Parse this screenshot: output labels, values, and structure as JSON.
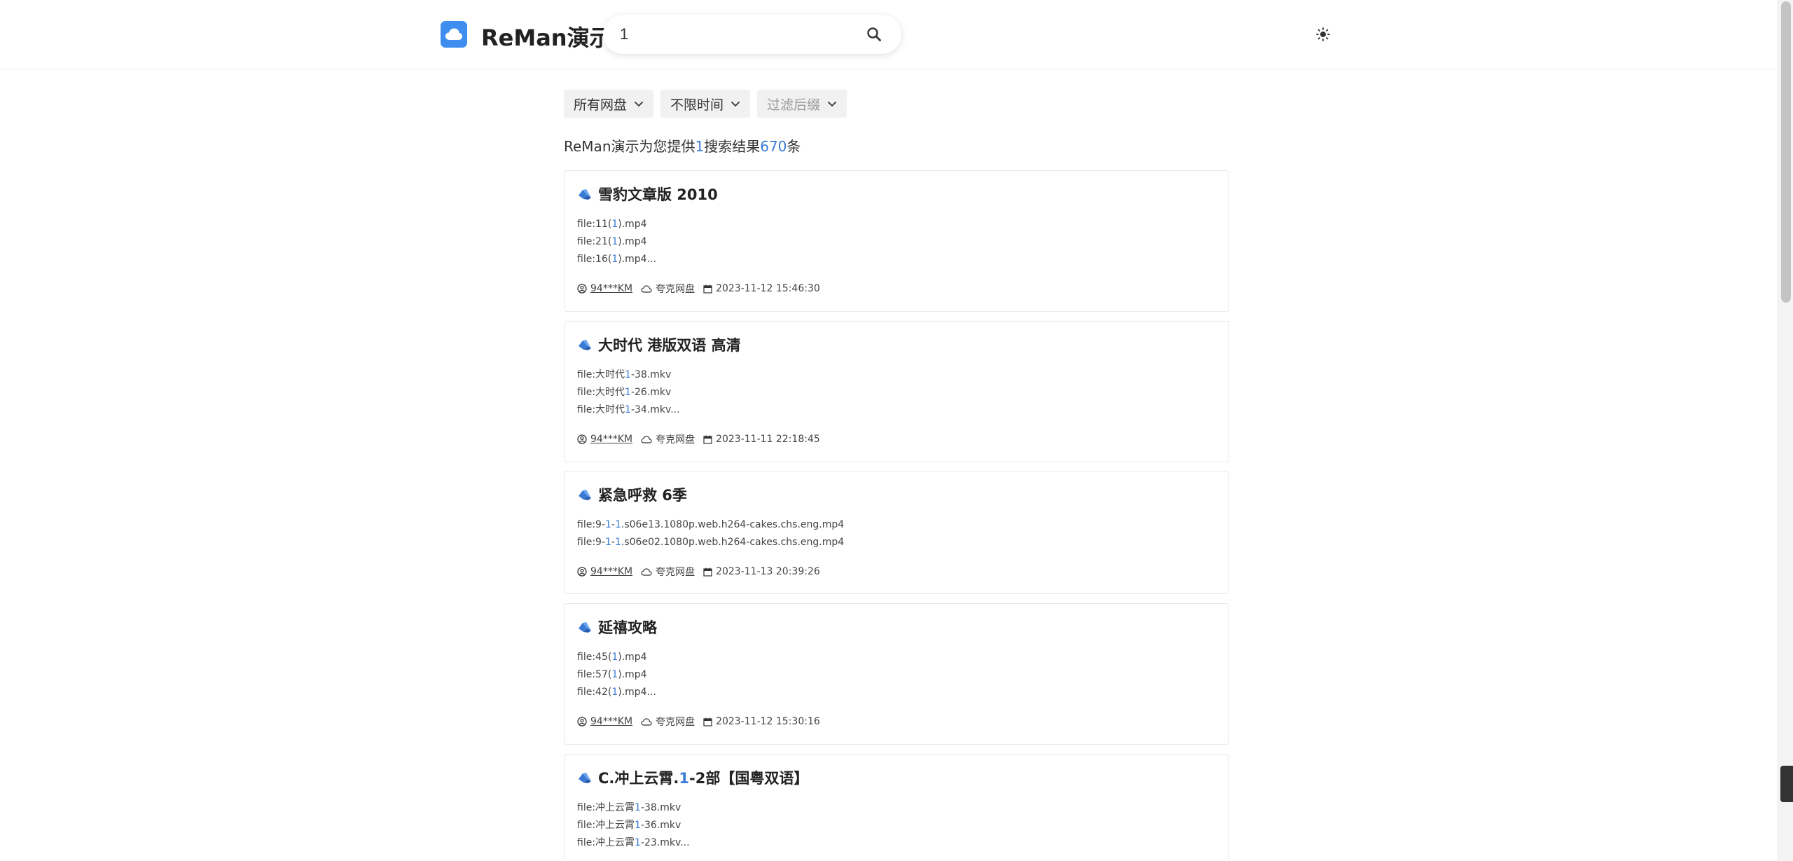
{
  "header": {
    "brand": "ReMan演示",
    "search_value": "1",
    "colors": {
      "logo": "#3d8eef",
      "accent": "#3a7bd5"
    }
  },
  "filters": [
    "所有网盘",
    "不限时间",
    "过滤后缀"
  ],
  "summary": {
    "prefix": "ReMan演示为您提供",
    "query": "1",
    "mid": "搜索结果",
    "count": "670",
    "suffix": "条"
  },
  "results": [
    {
      "title": "雪豹文章版 2010",
      "files": [
        [
          "file:11(",
          "1",
          ").mp4"
        ],
        [
          "file:21(",
          "1",
          ").mp4"
        ],
        [
          "file:16(",
          "1",
          ").mp4..."
        ]
      ],
      "user": "94***KM",
      "disk": "夸克网盘",
      "date": "2023-11-12 15:46:30"
    },
    {
      "title": "大时代 港版双语 高清",
      "files": [
        [
          "file:大时代",
          "1",
          "-38.mkv"
        ],
        [
          "file:大时代",
          "1",
          "-26.mkv"
        ],
        [
          "file:大时代",
          "1",
          "-34.mkv..."
        ]
      ],
      "user": "94***KM",
      "disk": "夸克网盘",
      "date": "2023-11-11 22:18:45"
    },
    {
      "title": "紧急呼救 6季",
      "files": [
        [
          "file:9-",
          "1",
          "-",
          "1",
          ".s06e13.1080p.web.h264-cakes.chs.eng.mp4"
        ],
        [
          "file:9-",
          "1",
          "-",
          "1",
          ".s06e02.1080p.web.h264-cakes.chs.eng.mp4"
        ]
      ],
      "user": "94***KM",
      "disk": "夸克网盘",
      "date": "2023-11-13 20:39:26"
    },
    {
      "title": "延禧攻略",
      "files": [
        [
          "file:45(",
          "1",
          ").mp4"
        ],
        [
          "file:57(",
          "1",
          ").mp4"
        ],
        [
          "file:42(",
          "1",
          ").mp4..."
        ]
      ],
      "user": "94***KM",
      "disk": "夸克网盘",
      "date": "2023-11-12 15:30:16"
    },
    {
      "title_parts": [
        "C.冲上云霄.",
        "1",
        "-2部【国粤双语】"
      ],
      "files": [
        [
          "file:冲上云霄",
          "1",
          "-38.mkv"
        ],
        [
          "file:冲上云霄",
          "1",
          "-36.mkv"
        ],
        [
          "file:冲上云霄",
          "1",
          "-23.mkv..."
        ]
      ]
    }
  ],
  "icons": {
    "logo": "cloud-icon",
    "search": "search-icon",
    "theme": "sun-icon",
    "dropdown": "chevron-down-icon",
    "result": "quark-drive-icon",
    "user": "user-icon",
    "disk": "cloud-outline-icon",
    "date": "calendar-icon"
  }
}
